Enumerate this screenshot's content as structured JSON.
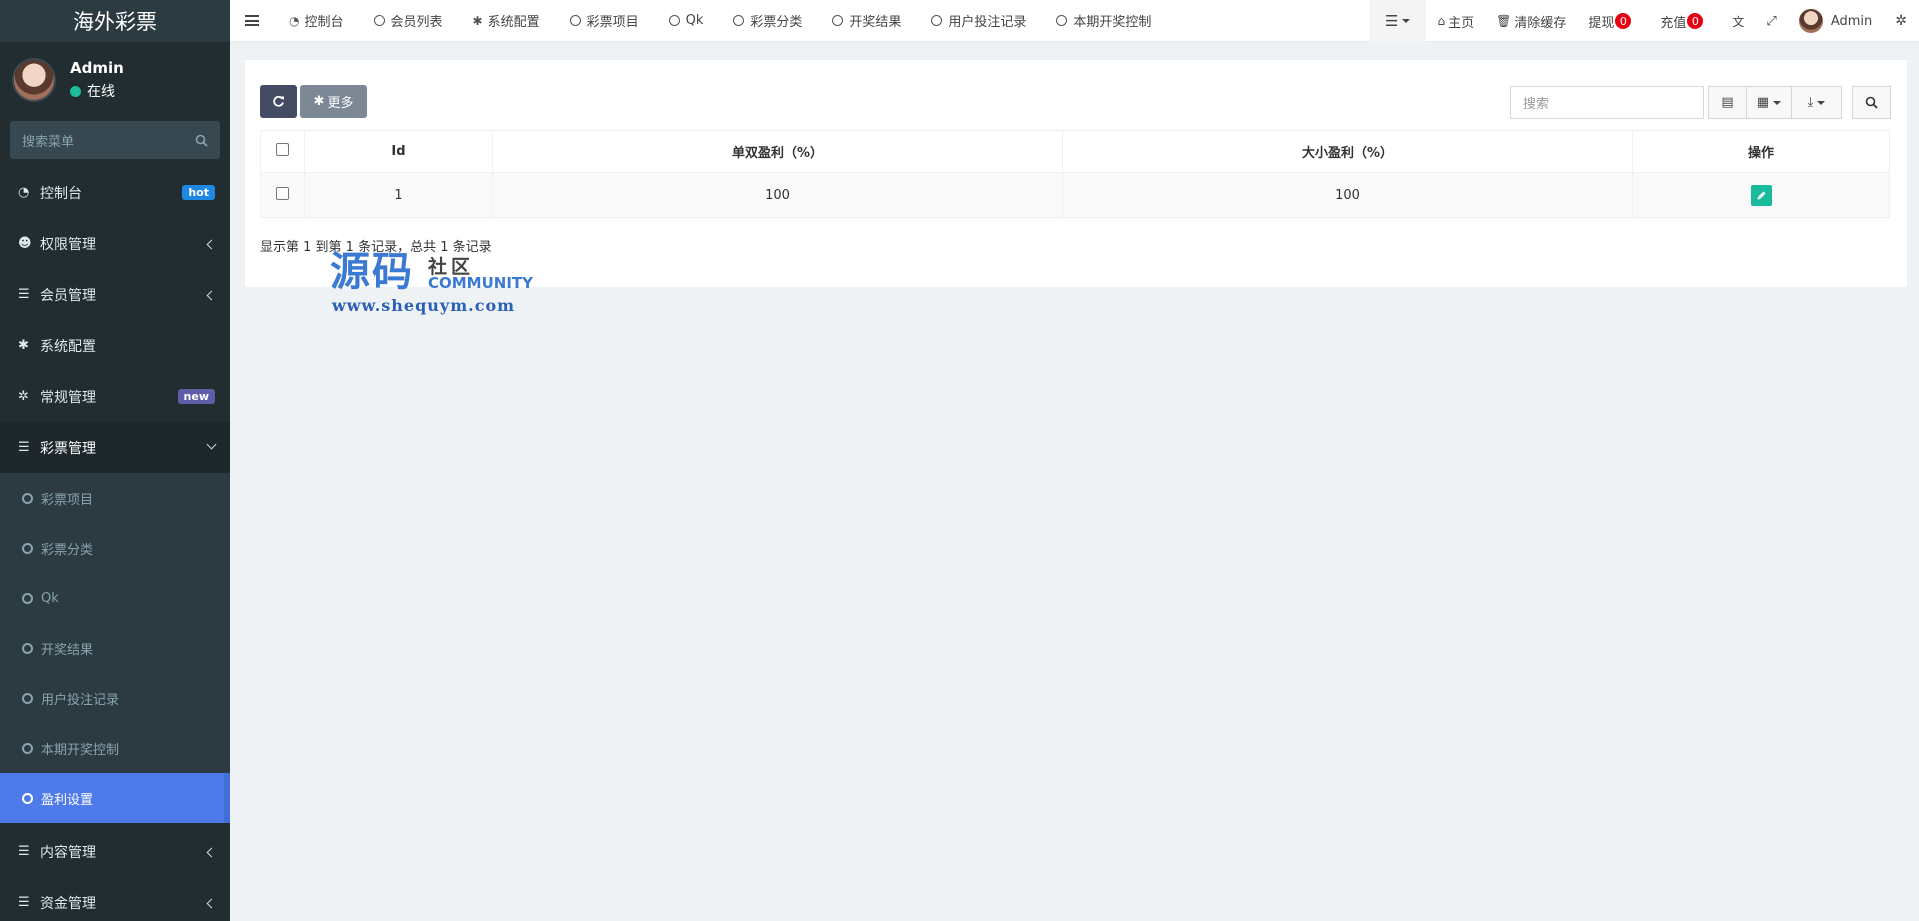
{
  "sidebar": {
    "brand": "海外彩票",
    "user": {
      "name": "Admin",
      "status": "在线"
    },
    "search_placeholder": "搜索菜单",
    "menu": [
      {
        "label": "控制台",
        "badge": "hot"
      },
      {
        "label": "权限管理"
      },
      {
        "label": "会员管理"
      },
      {
        "label": "系统配置"
      },
      {
        "label": "常规管理",
        "badge": "new"
      },
      {
        "label": "彩票管理"
      }
    ],
    "submenu": [
      "彩票项目",
      "彩票分类",
      "Qk",
      "开奖结果",
      "用户投注记录",
      "本期开奖控制",
      "盈利设置"
    ],
    "menu_after": [
      {
        "label": "内容管理"
      },
      {
        "label": "资金管理"
      }
    ]
  },
  "topbar": {
    "tabs": [
      "控制台",
      "会员列表",
      "系统配置",
      "彩票项目",
      "Qk",
      "彩票分类",
      "开奖结果",
      "用户投注记录",
      "本期开奖控制"
    ],
    "home": "主页",
    "clear_cache": "清除缓存",
    "withdraw": "提现",
    "withdraw_count": "0",
    "recharge": "充值",
    "recharge_count": "0",
    "admin": "Admin"
  },
  "toolbar": {
    "more_label": "更多",
    "search_placeholder": "搜索"
  },
  "table": {
    "headers": [
      "Id",
      "单双盈利（%）",
      "大小盈利（%）",
      "操作"
    ],
    "rows": [
      {
        "id": "1",
        "odd_even": "100",
        "big_small": "100"
      }
    ]
  },
  "footer": "显示第 1 到第 1 条记录，总共 1 条记录",
  "watermark": {
    "big": "源码",
    "small": "社区",
    "community": "COMMUNITY",
    "url": "www.shequym.com"
  },
  "colors": {
    "sidebar_bg": "#222d32",
    "active_item": "#4f7bea",
    "edit_button": "#18bc9c",
    "badge_red": "#e60012"
  }
}
